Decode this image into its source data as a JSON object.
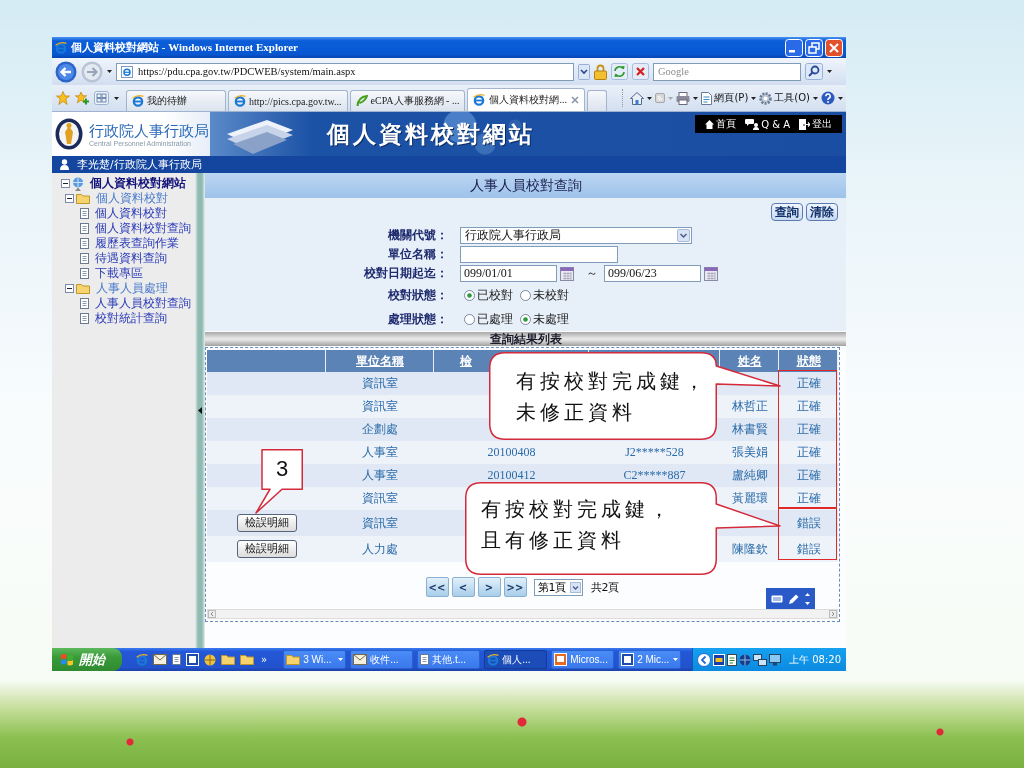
{
  "window": {
    "title": "個人資料校對網站 - Windows Internet Explorer"
  },
  "address_bar": {
    "url": "https://pdu.cpa.gov.tw/PDCWEB/system/main.aspx",
    "search_placeholder": "Google"
  },
  "tabs": [
    {
      "label": "我的待辦",
      "kind": "ie",
      "selected": false
    },
    {
      "label": "http://pics.cpa.gov.tw...",
      "kind": "ie",
      "selected": false
    },
    {
      "label": "eCPA人事服務網 - ...",
      "kind": "ecpa",
      "selected": false
    },
    {
      "label": "個人資料校對網...",
      "kind": "ie",
      "selected": true
    }
  ],
  "command_bar": [
    {
      "label": "網頁(P)"
    },
    {
      "label": "工具(O)"
    }
  ],
  "site_header": {
    "logo_title": "行政院人事行政局",
    "logo_subtitle": "Central Personnel Administration",
    "banner": "個人資料校對網站",
    "nav": [
      {
        "kind": "home",
        "label": "首頁"
      },
      {
        "kind": "qa",
        "label": "Q & A"
      },
      {
        "kind": "logout",
        "label": "登出"
      }
    ]
  },
  "user_bar": {
    "user": "李光楚/行政院人事行政局"
  },
  "sidebar": {
    "tree": [
      {
        "label": "個人資料校對網站",
        "kind": "root",
        "expanded": true,
        "children": [
          {
            "label": "個人資料校對",
            "kind": "folder",
            "expanded": true,
            "children": [
              {
                "label": "個人資料校對",
                "kind": "page"
              },
              {
                "label": "個人資料校對查詢",
                "kind": "page"
              },
              {
                "label": "履歷表查詢作業",
                "kind": "page"
              },
              {
                "label": "待遇資料查詢",
                "kind": "page"
              },
              {
                "label": "下載專區",
                "kind": "page"
              }
            ]
          },
          {
            "label": "人事人員處理",
            "kind": "folder",
            "expanded": true,
            "children": [
              {
                "label": "人事人員校對查詢",
                "kind": "page"
              },
              {
                "label": "校對統計查詢",
                "kind": "page"
              }
            ]
          }
        ]
      }
    ]
  },
  "main": {
    "title": "人事人員校對查詢",
    "actions": [
      "查詢",
      "清除"
    ],
    "form": [
      {
        "kind": "select",
        "label": "機關代號：",
        "value": "行政院人事行政局"
      },
      {
        "kind": "text",
        "label": "單位名稱："
      },
      {
        "kind": "date_range",
        "label": "校對日期起迄：",
        "from": "099/01/01",
        "separator": "～",
        "to": "099/06/23"
      },
      {
        "kind": "radio",
        "label": "校對狀態：",
        "options": [
          {
            "label": "已校對",
            "selected": true
          },
          {
            "label": "未校對",
            "selected": false
          }
        ]
      },
      {
        "kind": "radio",
        "label": "處理狀態：",
        "options": [
          {
            "label": "已處理",
            "selected": false
          },
          {
            "label": "未處理",
            "selected": true
          }
        ]
      }
    ],
    "results": {
      "title": "查詢結果列表",
      "columns": {
        "unit": "單位名稱",
        "column_3": "檢",
        "name": "姓名",
        "status": "狀態"
      },
      "rows": [
        {
          "unit": "資訊室",
          "status": "正確",
          "marked": true
        },
        {
          "unit": "資訊室",
          "name": "林哲正",
          "status": "正確",
          "marked": true
        },
        {
          "unit": "企劃處",
          "name": "林書賢",
          "status": "正確",
          "marked": true
        },
        {
          "unit": "人事室",
          "column_3": "20100408",
          "column_4": "J2*****528",
          "name": "張美娟",
          "status": "正確",
          "marked": true
        },
        {
          "unit": "人事室",
          "column_3": "20100412",
          "column_4": "C2*****887",
          "name": "盧純卿",
          "status": "正確",
          "marked": true
        },
        {
          "unit": "資訊室",
          "name": "黃麗環",
          "status": "正確",
          "marked": true
        },
        {
          "button": "檢誤明細",
          "unit": "資訊室",
          "status": "錯誤",
          "marked": true
        },
        {
          "button": "檢誤明細",
          "unit": "人力處",
          "name": "陳隆欽",
          "status": "錯誤",
          "marked": true
        }
      ],
      "pagination": {
        "buttons": [
          "<<",
          "<",
          ">",
          ">>"
        ],
        "page": "第1頁",
        "total": "共2頁"
      }
    }
  },
  "annotations": [
    {
      "kind": "callout",
      "lines": [
        "有按校對完成鍵，",
        "未修正資料"
      ]
    },
    {
      "kind": "callout",
      "lines": [
        "有按校對完成鍵，",
        "且有修正資料"
      ]
    },
    {
      "kind": "number",
      "text": "3"
    }
  ],
  "taskbar": {
    "start": "開始",
    "overflow": "»",
    "tasks": [
      {
        "kind": "folder",
        "label": "3 Wi...",
        "grouped": true,
        "selected": false
      },
      {
        "kind": "mail",
        "label": "收件...",
        "grouped": false,
        "selected": false
      },
      {
        "kind": "doc",
        "label": "其他.t...",
        "grouped": false,
        "selected": false
      },
      {
        "kind": "ie",
        "label": "個人...",
        "grouped": false,
        "selected": true
      },
      {
        "kind": "slides",
        "label": "Micros...",
        "grouped": false,
        "selected": false
      },
      {
        "kind": "word",
        "label": "2 Mic...",
        "grouped": true,
        "selected": false
      }
    ],
    "clock": "上午 08:20"
  }
}
